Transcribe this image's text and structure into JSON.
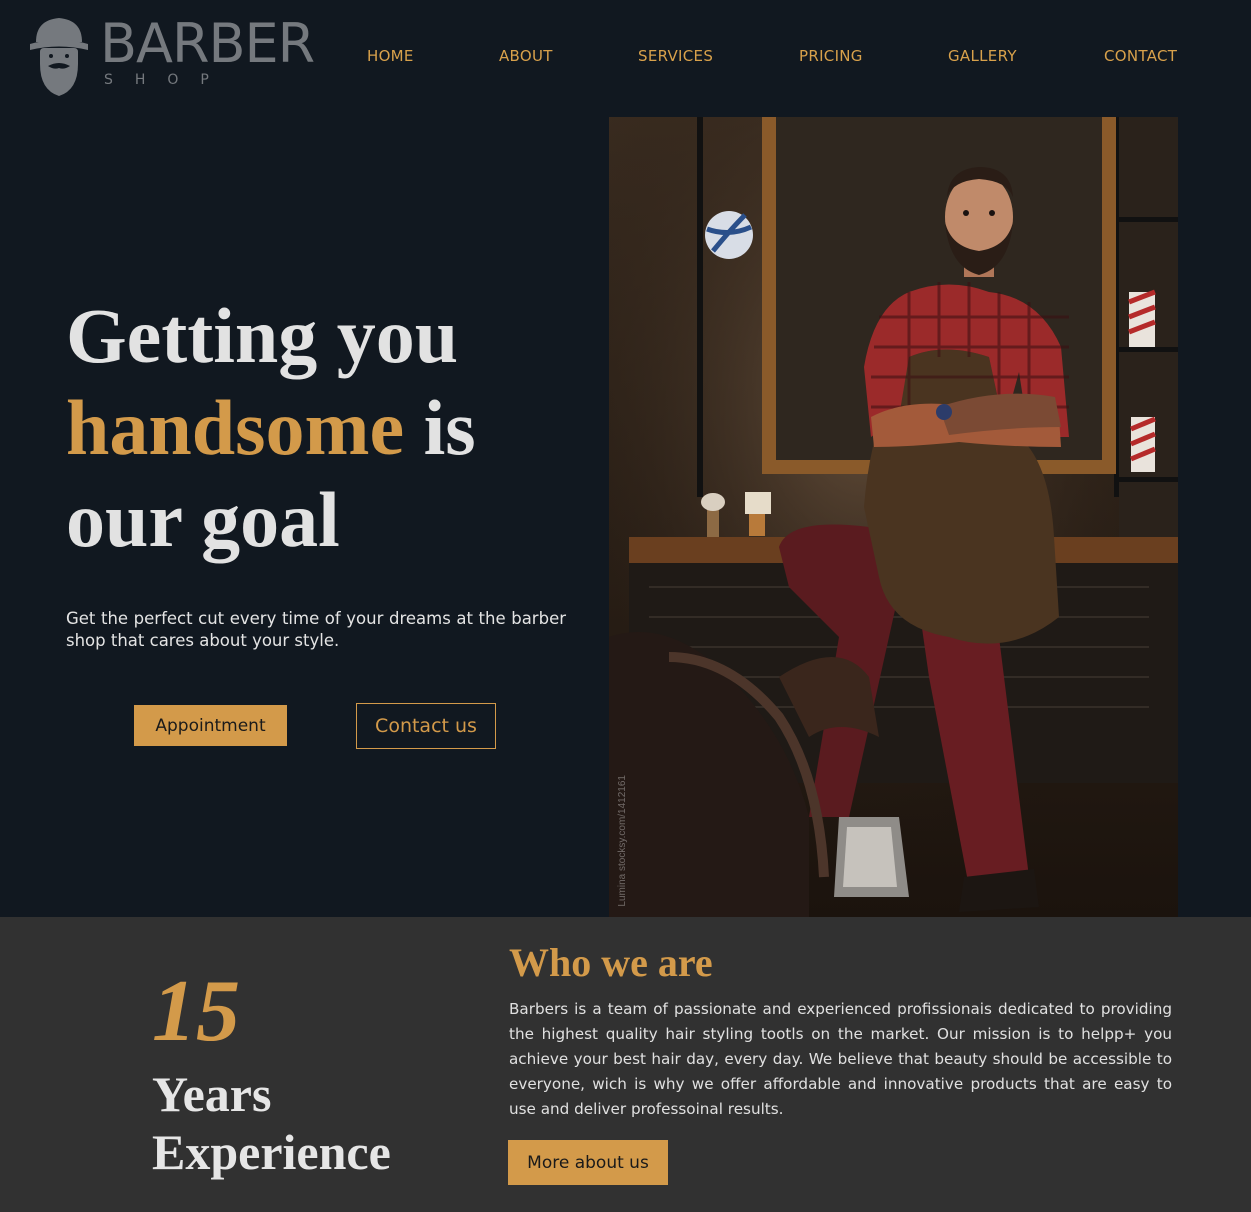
{
  "brand": {
    "name": "BARBER",
    "sub": "SHOP"
  },
  "nav": {
    "items": [
      {
        "label": "HOME"
      },
      {
        "label": "ABOUT"
      },
      {
        "label": "SERVICES"
      },
      {
        "label": "PRICING"
      },
      {
        "label": "GALLERY"
      },
      {
        "label": "CONTACT"
      }
    ]
  },
  "hero": {
    "title_part1": "Getting you",
    "title_highlight": "handsome",
    "title_part2": "is",
    "title_part3": "our goal",
    "subtitle": "Get the perfect cut every time of your dreams at the barber shop that cares about your style.",
    "appointment_button": "Appointment",
    "contact_button": "Contact us",
    "photo_credit": "Lumina stocksy.com/1412161"
  },
  "about": {
    "years_number": "15",
    "years_label": "Years Experience",
    "title": "Who we are",
    "text": "Barbers is a team of passionate and experienced profissionais dedicated to providing the highest quality hair styling tootls on the market. Our mission is to helpp+ you achieve your best hair day, every day. We believe that beauty should be accessible to everyone, wich is why we offer affordable and innovative products that are easy to use and deliver professoinal results.",
    "more_button": "More about us"
  },
  "colors": {
    "background": "#111820",
    "accent": "#d39a4a",
    "about_background": "#313131",
    "logo_gray": "#75797e"
  },
  "icons": {
    "logo": "bearded-man-with-hat-icon"
  }
}
